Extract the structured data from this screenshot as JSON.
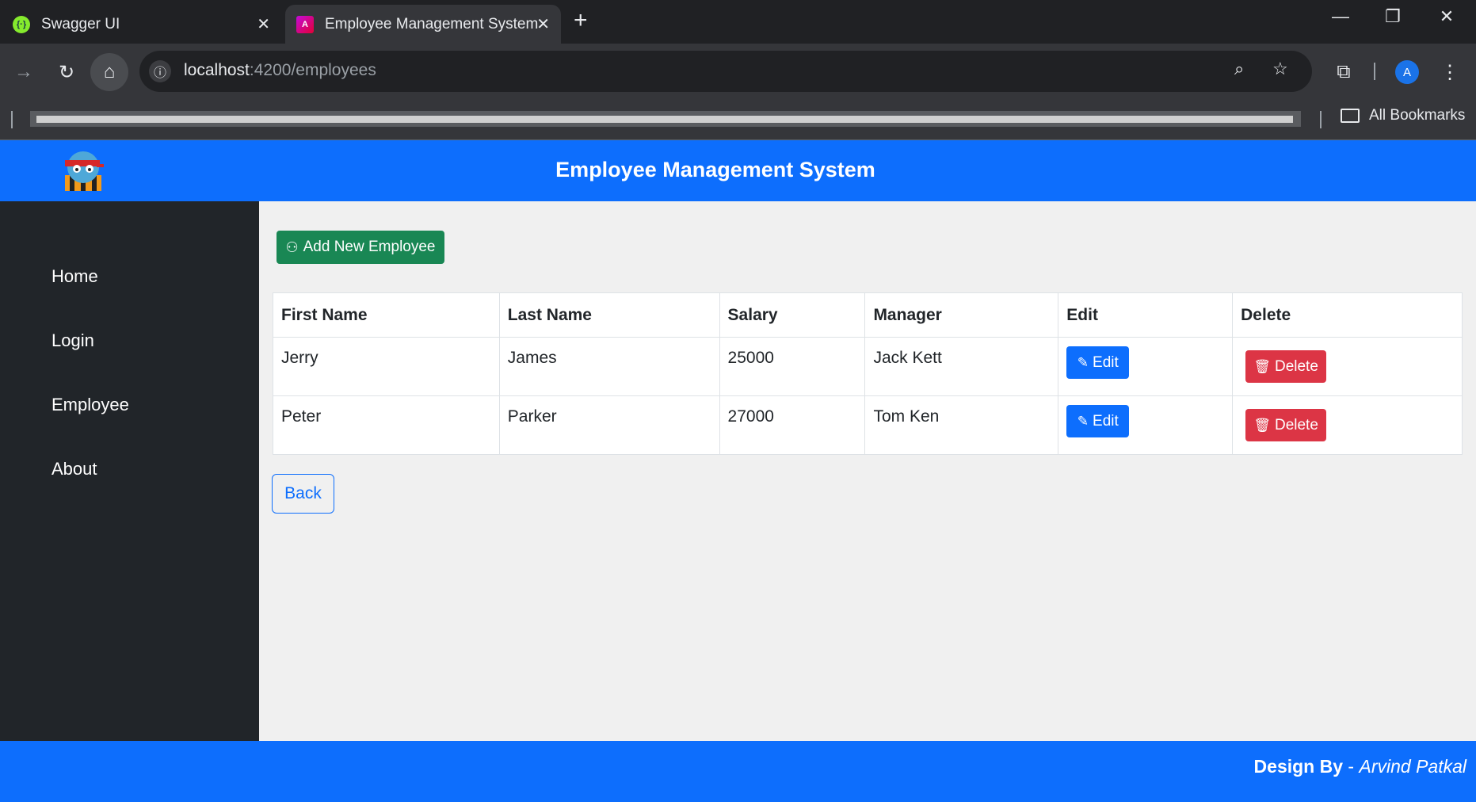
{
  "browser": {
    "tabs": [
      {
        "title": "Swagger UI",
        "favicon": "swagger-icon"
      },
      {
        "title": "Employee Management System",
        "favicon": "angular-icon",
        "active": true
      }
    ],
    "new_tab": "+",
    "address": {
      "host": "localhost",
      "path": ":4200/employees"
    },
    "bookmarks_label": "All Bookmarks",
    "profile_initial": "A"
  },
  "header": {
    "title": "Employee Management System"
  },
  "sidebar": {
    "items": [
      {
        "label": "Home"
      },
      {
        "label": "Login"
      },
      {
        "label": "Employee"
      },
      {
        "label": "About"
      }
    ]
  },
  "main": {
    "add_button_label": "Add New Employee",
    "back_button_label": "Back",
    "table": {
      "columns": [
        "First Name",
        "Last Name",
        "Salary",
        "Manager",
        "Edit",
        "Delete"
      ],
      "rows": [
        {
          "first_name": "Jerry",
          "last_name": "James",
          "salary": "25000",
          "manager": "Jack Kett",
          "edit_label": "Edit",
          "delete_label": "Delete"
        },
        {
          "first_name": "Peter",
          "last_name": "Parker",
          "salary": "27000",
          "manager": "Tom Ken",
          "edit_label": "Edit",
          "delete_label": "Delete"
        }
      ]
    }
  },
  "footer": {
    "prefix": "Design By",
    "separator": " - ",
    "author": "Arvind Patkal"
  },
  "colors": {
    "primary": "#0d6efd",
    "success": "#198754",
    "danger": "#dc3545",
    "sidebar": "#212529"
  }
}
